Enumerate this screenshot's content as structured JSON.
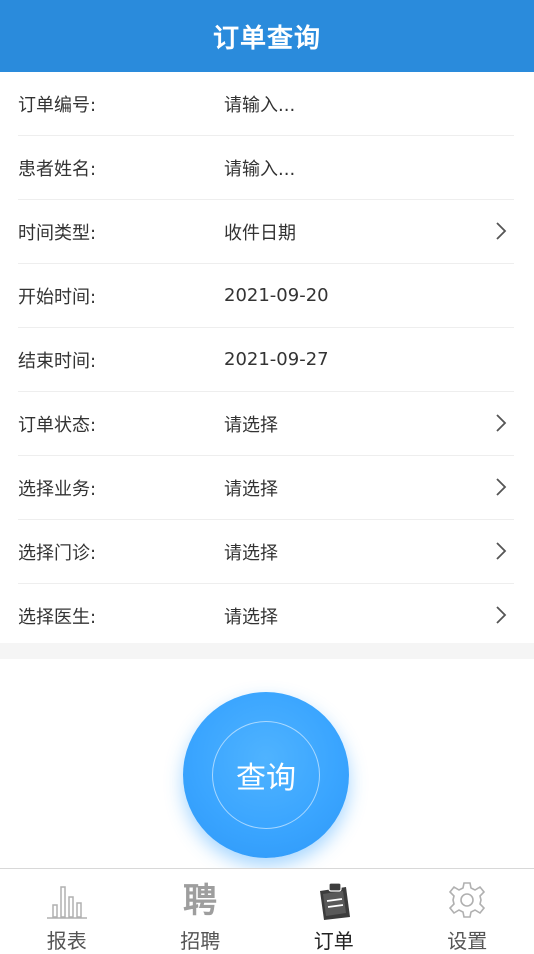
{
  "header": {
    "title": "订单查询"
  },
  "form": {
    "rows": [
      {
        "label": "订单编号:",
        "value": "请输入..."
      },
      {
        "label": "患者姓名:",
        "value": "请输入..."
      },
      {
        "label": "时间类型:",
        "value": "收件日期"
      },
      {
        "label": "开始时间:",
        "value": "2021-09-20"
      },
      {
        "label": "结束时间:",
        "value": "2021-09-27"
      },
      {
        "label": "订单状态:",
        "value": "请选择"
      },
      {
        "label": "选择业务:",
        "value": "请选择"
      },
      {
        "label": "选择门诊:",
        "value": "请选择"
      },
      {
        "label": "选择医生:",
        "value": "请选择"
      }
    ]
  },
  "query_button": {
    "label": "查询"
  },
  "tabbar": {
    "tabs": [
      {
        "label": "报表",
        "icon": "bar-chart-icon"
      },
      {
        "label": "招聘",
        "icon": "pin-character-icon",
        "glyph": "聘"
      },
      {
        "label": "订单",
        "icon": "clipboard-icon",
        "active": true
      },
      {
        "label": "设置",
        "icon": "gear-icon"
      }
    ]
  },
  "colors": {
    "header_bg": "#2a8bdc",
    "button": "#3aa5ff"
  }
}
